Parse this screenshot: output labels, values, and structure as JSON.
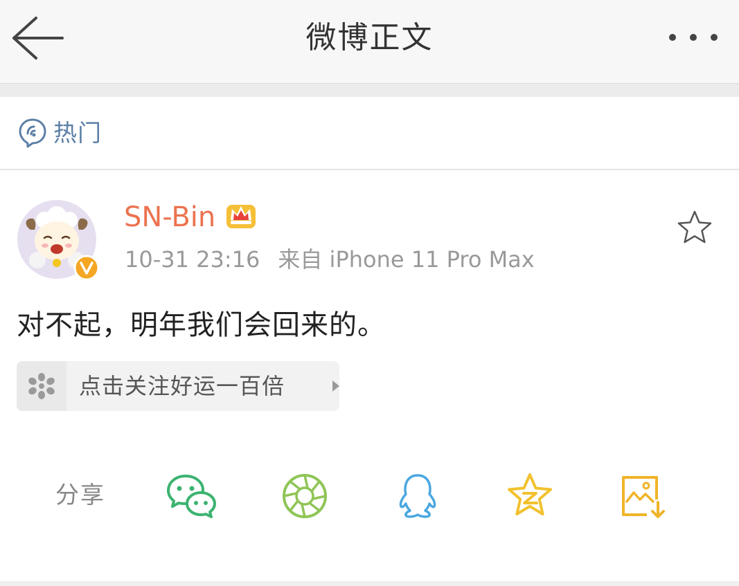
{
  "navbar": {
    "title": "微博正文",
    "back_icon": "back-arrow-icon",
    "more_icon": "more-dots-icon"
  },
  "hot": {
    "label": "热门",
    "icon": "hot-topic-icon",
    "color": "#5b7fa6"
  },
  "post": {
    "author": {
      "name": "SN-Bin",
      "name_color": "#eb7350",
      "badge_icon": "crown-icon",
      "verified_icon": "verified-v-icon",
      "verified_color": "#f5a623"
    },
    "timestamp": "10-31 23:16",
    "source": "来自 iPhone 11 Pro Max",
    "text": "对不起，明年我们会回来的。",
    "favorite_icon": "star-outline-icon",
    "promo": {
      "label": "点击关注好运一百倍",
      "icon": "flower-icon"
    }
  },
  "share": {
    "label": "分享",
    "targets": [
      {
        "name": "wechat",
        "icon": "wechat-icon",
        "color": "#3cb371"
      },
      {
        "name": "moments",
        "icon": "moments-icon",
        "color": "#8fc556"
      },
      {
        "name": "qq",
        "icon": "qq-icon",
        "color": "#4aa7e0"
      },
      {
        "name": "qzone",
        "icon": "qzone-icon",
        "color": "#f2c12e"
      },
      {
        "name": "save-image",
        "icon": "save-image-icon",
        "color": "#f0b429"
      }
    ]
  }
}
